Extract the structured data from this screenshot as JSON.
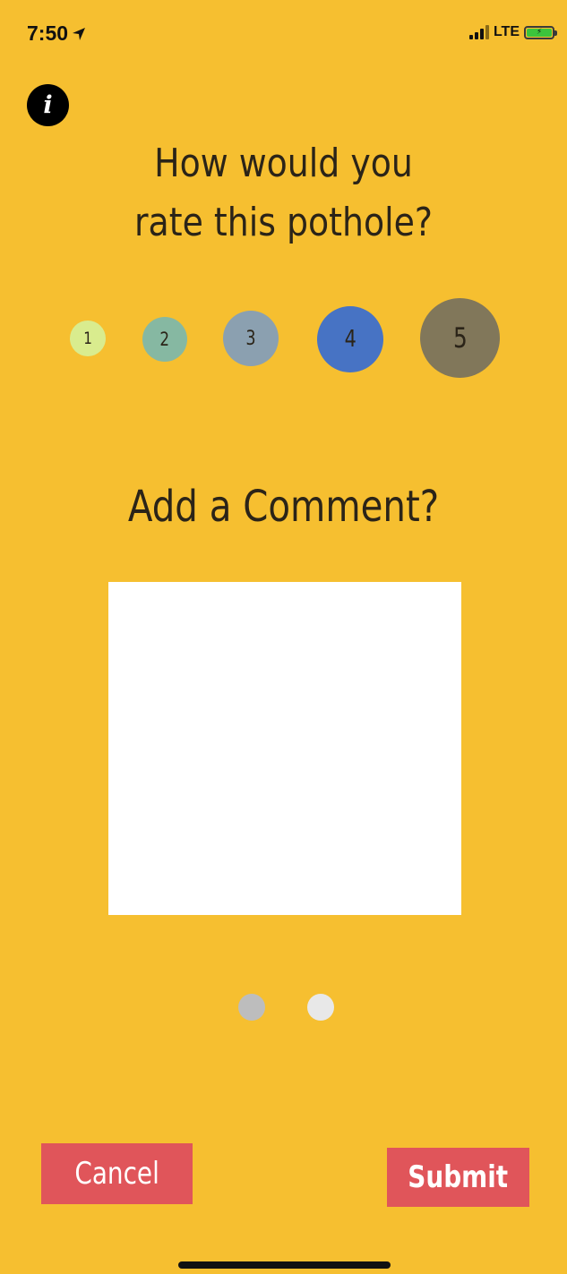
{
  "status_bar": {
    "time": "7:50",
    "network": "LTE",
    "location_icon": "location-arrow-icon",
    "signal_icon": "signal-bars-icon",
    "battery_icon": "battery-charging-icon"
  },
  "info_button": {
    "label": "i",
    "icon": "info-icon"
  },
  "rating": {
    "question_line1": "How would you",
    "question_line2": "rate this pothole?",
    "options": [
      {
        "label": "1",
        "color": "#D9EC8E"
      },
      {
        "label": "2",
        "color": "#86B8A2"
      },
      {
        "label": "3",
        "color": "#8BA0B0"
      },
      {
        "label": "4",
        "color": "#4773C4"
      },
      {
        "label": "5",
        "color": "#81775A"
      }
    ]
  },
  "comment": {
    "heading": "Add a Comment?",
    "value": ""
  },
  "pager": {
    "dots": [
      {
        "color": "#BDBDBD"
      },
      {
        "color": "#E8E8E8"
      }
    ]
  },
  "actions": {
    "cancel_label": "Cancel",
    "submit_label": "Submit"
  },
  "colors": {
    "background": "#F6BF30",
    "button": "#E0555A",
    "text": "#2B2418"
  }
}
